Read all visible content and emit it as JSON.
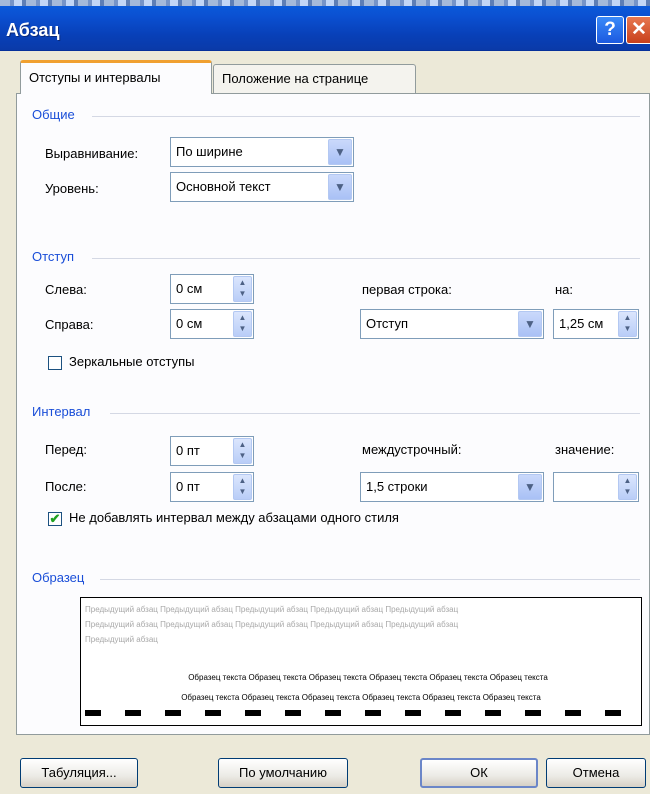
{
  "window": {
    "title": "Абзац",
    "help_glyph": "?",
    "close_glyph": "✕"
  },
  "tabs": [
    {
      "label": "Отступы и интервалы",
      "active": true
    },
    {
      "label": "Положение на странице",
      "active": false
    }
  ],
  "general": {
    "section_title": "Общие",
    "alignment": {
      "label": "Выравнивание:",
      "value": "По ширине"
    },
    "level": {
      "label": "Уровень:",
      "value": "Основной текст"
    }
  },
  "indent": {
    "section_title": "Отступ",
    "left": {
      "label": "Слева:",
      "value": "0 см"
    },
    "right": {
      "label": "Справа:",
      "value": "0 см"
    },
    "first_line": {
      "label": "первая строка:",
      "value": "Отступ"
    },
    "by": {
      "label": "на:",
      "value": "1,25 см"
    },
    "mirror": {
      "label": "Зеркальные отступы",
      "checked": false
    }
  },
  "spacing": {
    "section_title": "Интервал",
    "before": {
      "label": "Перед:",
      "value": "0 пт"
    },
    "after": {
      "label": "После:",
      "value": "0 пт"
    },
    "line_spacing": {
      "label": "междустрочный:",
      "value": "1,5 строки"
    },
    "at": {
      "label": "значение:",
      "value": ""
    },
    "no_space_same_style": {
      "label": "Не добавлять интервал между абзацами одного стиля",
      "checked": true,
      "check_glyph": "✔"
    }
  },
  "preview": {
    "section_title": "Образец",
    "prev_line1": "Предыдущий абзац Предыдущий абзац Предыдущий абзац Предыдущий абзац Предыдущий абзац",
    "prev_line2": "Предыдущий абзац Предыдущий абзац Предыдущий абзац Предыдущий абзац Предыдущий абзац",
    "prev_line3": "Предыдущий абзац",
    "sample_line1": "Образец текста Образец текста Образец текста Образец текста Образец текста Образец текста",
    "sample_line2": "Образец текста Образец текста Образец текста Образец текста Образец текста Образец текста"
  },
  "buttons": {
    "tabs": "Табуляция...",
    "default": "По умолчанию",
    "ok": "ОК",
    "cancel": "Отмена"
  },
  "icons": {
    "dropdown": "chevron-down-icon",
    "spinner": "spinner-icon",
    "help": "help-icon",
    "close": "close-icon"
  },
  "colors": {
    "titlebar": "#0b4fd0",
    "section_title": "#1a4ed8",
    "dialog_bg": "#ece9d8",
    "tab_highlight": "#f0a030"
  }
}
